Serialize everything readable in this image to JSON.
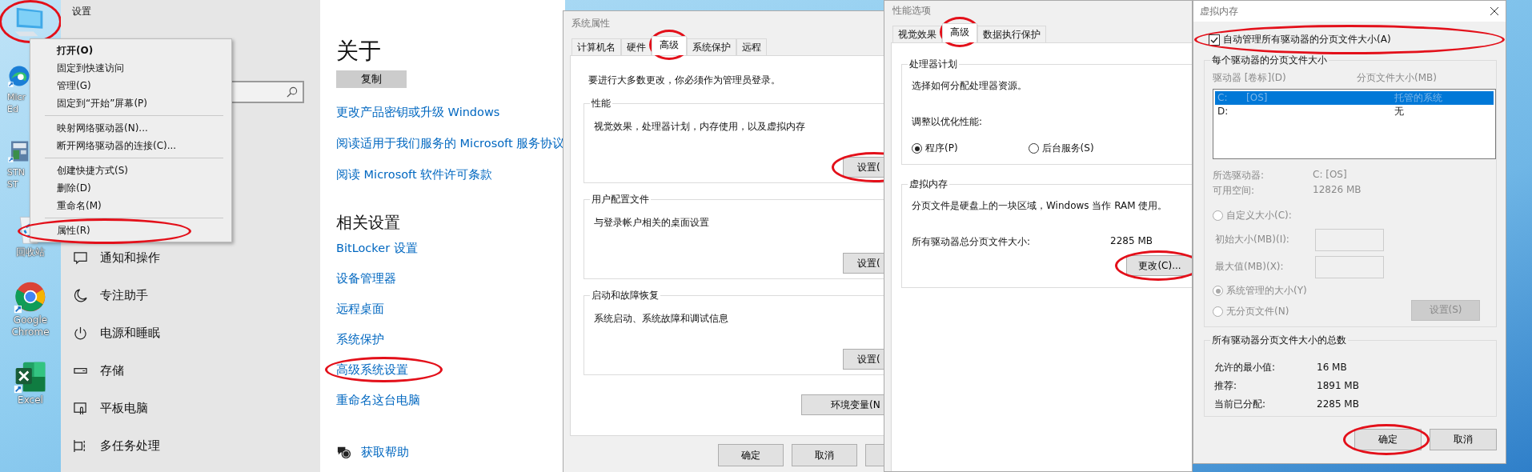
{
  "desktop": {
    "icons": [
      {
        "kind": "computer",
        "circled": true
      },
      {
        "kind": "browser-wave",
        "label": [
          "Micr",
          "Ed"
        ],
        "circled": false
      },
      {
        "kind": "board",
        "label": [
          "STN",
          "ST"
        ],
        "circled": false
      },
      {
        "kind": "recycle",
        "label": [
          "回收站"
        ],
        "circled": false
      },
      {
        "kind": "chrome",
        "label": [
          "Google",
          "Chrome"
        ],
        "circled": false
      },
      {
        "kind": "excel",
        "label": [
          "Excel"
        ],
        "circled": false
      }
    ]
  },
  "settings": {
    "title": "设置",
    "sidebar_items": [
      {
        "kind": "notification",
        "label": "通知和操作"
      },
      {
        "kind": "focus",
        "label": "专注助手"
      },
      {
        "kind": "power",
        "label": "电源和睡眠"
      },
      {
        "kind": "storage",
        "label": "存储"
      },
      {
        "kind": "tablet",
        "label": "平板电脑"
      },
      {
        "kind": "multitask",
        "label": "多任务处理"
      }
    ],
    "about": {
      "heading": "关于",
      "copy_button": "复制",
      "links": [
        "更改产品密钥或升级 Windows",
        "阅读适用于我们服务的 Microsoft 服务协议",
        "阅读 Microsoft 软件许可条款"
      ],
      "related_heading": "相关设置",
      "related_links": [
        {
          "label": "BitLocker 设置",
          "circled": false
        },
        {
          "label": "设备管理器",
          "circled": false
        },
        {
          "label": "远程桌面",
          "circled": false
        },
        {
          "label": "系统保护",
          "circled": false
        },
        {
          "label": "高级系统设置",
          "circled": true
        },
        {
          "label": "重命名这台电脑",
          "circled": false
        }
      ],
      "help_link": "获取帮助"
    }
  },
  "context_menu": {
    "groups": [
      [
        {
          "label": "打开(O)",
          "bold": true,
          "circled": false
        },
        {
          "label": "固定到快速访问",
          "bold": false,
          "circled": false
        },
        {
          "label": "管理(G)",
          "bold": false,
          "circled": false
        },
        {
          "label": "固定到“开始”屏幕(P)",
          "bold": false,
          "circled": false
        }
      ],
      [
        {
          "label": "映射网络驱动器(N)...",
          "bold": false,
          "circled": false
        },
        {
          "label": "断开网络驱动器的连接(C)...",
          "bold": false,
          "circled": false
        }
      ],
      [
        {
          "label": "创建快捷方式(S)",
          "bold": false,
          "circled": false
        },
        {
          "label": "删除(D)",
          "bold": false,
          "circled": false
        },
        {
          "label": "重命名(M)",
          "bold": false,
          "circled": false
        }
      ],
      [
        {
          "label": "属性(R)",
          "bold": false,
          "circled": true
        }
      ]
    ]
  },
  "system_properties": {
    "title": "系统属性",
    "tabs": [
      {
        "label": "计算机名",
        "selected": false,
        "circled": false
      },
      {
        "label": "硬件",
        "selected": false,
        "circled": false
      },
      {
        "label": "高级",
        "selected": true,
        "circled": true
      },
      {
        "label": "系统保护",
        "selected": false,
        "circled": false
      },
      {
        "label": "远程",
        "selected": false,
        "circled": false
      }
    ],
    "notice": "要进行大多数更改，你必须作为管理员登录。",
    "groups": [
      {
        "title": "性能",
        "description": "视觉效果，处理器计划，内存使用，以及虚拟内存",
        "button": "设置(",
        "circled": true
      },
      {
        "title": "用户配置文件",
        "description": "与登录帐户相关的桌面设置",
        "button": "设置(",
        "circled": false
      },
      {
        "title": "启动和故障恢复",
        "description": "系统启动、系统故障和调试信息",
        "button": "设置(",
        "circled": false
      }
    ],
    "env_button": "环境变量(N",
    "footer_buttons": [
      "确定",
      "取消"
    ]
  },
  "performance_options": {
    "title": "性能选项",
    "tabs": [
      {
        "label": "视觉效果",
        "selected": false,
        "circled": false
      },
      {
        "label": "高级",
        "selected": true,
        "circled": true
      },
      {
        "label": "数据执行保护",
        "selected": false,
        "circled": false
      }
    ],
    "processor": {
      "title": "处理器计划",
      "description": "选择如何分配处理器资源。",
      "prompt": "调整以优化性能:",
      "options": [
        {
          "label": "程序(P)",
          "selected": true
        },
        {
          "label": "后台服务(S)",
          "selected": false
        }
      ]
    },
    "virtual_memory": {
      "title": "虚拟内存",
      "description": "分页文件是硬盘上的一块区域，Windows 当作 RAM 使用。",
      "total_label": "所有驱动器总分页文件大小:",
      "total_value": "2285 MB",
      "change_button": "更改(C)...",
      "circled": true
    }
  },
  "virtual_memory": {
    "title": "虚拟内存",
    "auto_manage": {
      "label": "自动管理所有驱动器的分页文件大小(A)",
      "checked": true,
      "circled": true
    },
    "per_drive": {
      "title": "每个驱动器的分页文件大小",
      "disabled": true,
      "columns": [
        "驱动器 [卷标](D)",
        "分页文件大小(MB)"
      ],
      "drives": [
        {
          "drive": "C:",
          "label": "[OS]",
          "size": "托管的系统",
          "selected": true
        },
        {
          "drive": "D:",
          "size": "无",
          "selected": false
        }
      ],
      "info": [
        {
          "label": "所选驱动器:",
          "value": "C:  [OS]"
        },
        {
          "label": "可用空间:",
          "value": "12826 MB"
        }
      ],
      "options": [
        {
          "kind": "radio",
          "label": "自定义大小(C):",
          "selected": false
        },
        {
          "kind": "field",
          "label": "初始大小(MB)(I):"
        },
        {
          "kind": "field",
          "label": "最大值(MB)(X):"
        },
        {
          "kind": "radio",
          "label": "系统管理的大小(Y)",
          "selected": true
        },
        {
          "kind": "radio",
          "label": "无分页文件(N)",
          "selected": false
        }
      ],
      "set_button": "设置(S)"
    },
    "totals": {
      "title": "所有驱动器分页文件大小的总数",
      "rows": [
        {
          "label": "允许的最小值:",
          "value": "16 MB"
        },
        {
          "label": "推荐:",
          "value": "1891 MB"
        },
        {
          "label": "当前已分配:",
          "value": "2285 MB"
        }
      ]
    },
    "buttons": [
      {
        "label": "确定",
        "circled": true
      },
      {
        "label": "取消",
        "circled": false
      }
    ]
  }
}
